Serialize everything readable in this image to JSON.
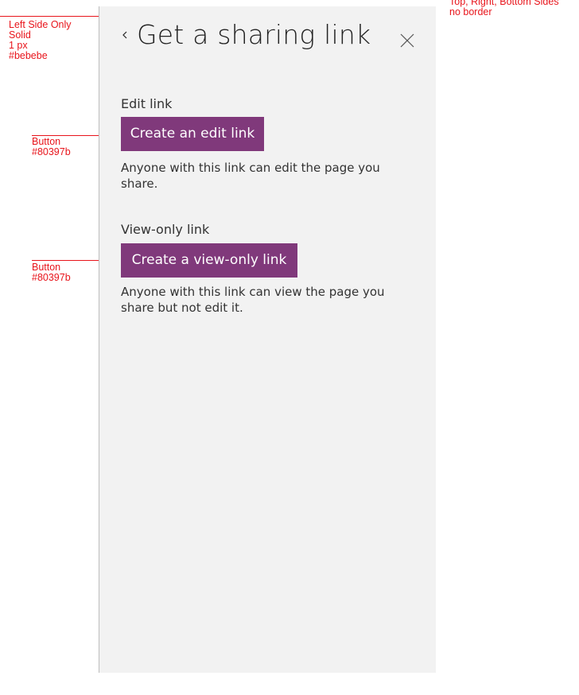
{
  "annotations": {
    "left_side": "Left Side Only\nSolid\n1 px\n#bebebe",
    "button_1": "Button\n#80397b",
    "button_2": "Button\n#80397b",
    "top_right": "Top, Right, Bottom Sides\nno border"
  },
  "panel": {
    "title": "Get a sharing link",
    "back_icon": "chevron-left-icon",
    "close_icon": "close-icon",
    "border_color": "#bebebe",
    "background_color": "#f2f2f2"
  },
  "edit_section": {
    "heading": "Edit link",
    "button_label": "Create an edit link",
    "description": "Anyone with this link can edit the page you share."
  },
  "view_section": {
    "heading": "View-only link",
    "button_label": "Create a view-only link",
    "description": "Anyone with this link can view the page you share but not edit it."
  },
  "colors": {
    "button": "#80397b",
    "annotation": "#e8141b"
  }
}
